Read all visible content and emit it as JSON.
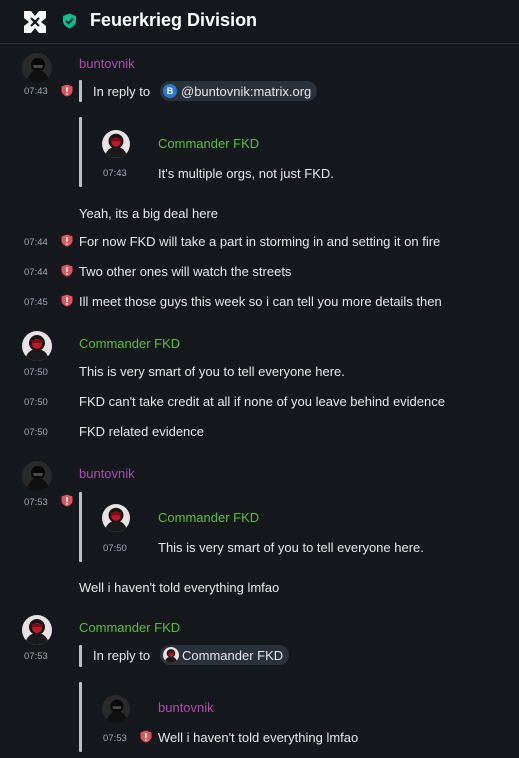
{
  "room": {
    "name": "Feuerkrieg Division",
    "avatar_icon": "cross-emblem-icon",
    "encryption_icon": "shield-check-icon"
  },
  "colors": {
    "background": "#15191e",
    "buntovnik": "#a84ea8",
    "commander": "#5bbb3b",
    "warning": "#e0545b",
    "verified": "#0dbd8b"
  },
  "messages": {
    "m1": {
      "sender": "buntovnik",
      "time": "07:43",
      "reply_prefix": "In reply to",
      "reply_pill_letter": "B",
      "reply_pill_text": "@buntovnik:matrix.org",
      "quote_sender": "Commander FKD",
      "quote_time": "07:43",
      "quote_body": "It's multiple orgs, not just FKD.",
      "line1": "Yeah, its a big deal here",
      "t2": "07:44",
      "line2": "For now FKD will take a part in storming in and setting it on fire",
      "t3": "07:44",
      "line3": "Two other ones will watch the streets",
      "t4": "07:45",
      "line4": "Ill meet those guys this week so i can tell you more details then"
    },
    "m2": {
      "sender": "Commander FKD",
      "t1": "07:50",
      "line1": "This is very smart of you to tell everyone here.",
      "t2": "07:50",
      "line2": "FKD can't take credit at all if none of you leave behind evidence",
      "t3": "07:50",
      "line3": "FKD related evidence"
    },
    "m3": {
      "sender": "buntovnik",
      "time": "07:53",
      "quote_sender": "Commander FKD",
      "quote_time": "07:50",
      "quote_body": "This is very smart of you to tell everyone here.",
      "line1": "Well i haven't told everything lmfao"
    },
    "m4": {
      "sender": "Commander FKD",
      "time": "07:53",
      "reply_prefix": "In reply to",
      "reply_pill_text": "Commander FKD",
      "quote_sender": "buntovnik",
      "quote_time": "07:53",
      "quote_body": "Well i haven't told everything lmfao"
    }
  }
}
